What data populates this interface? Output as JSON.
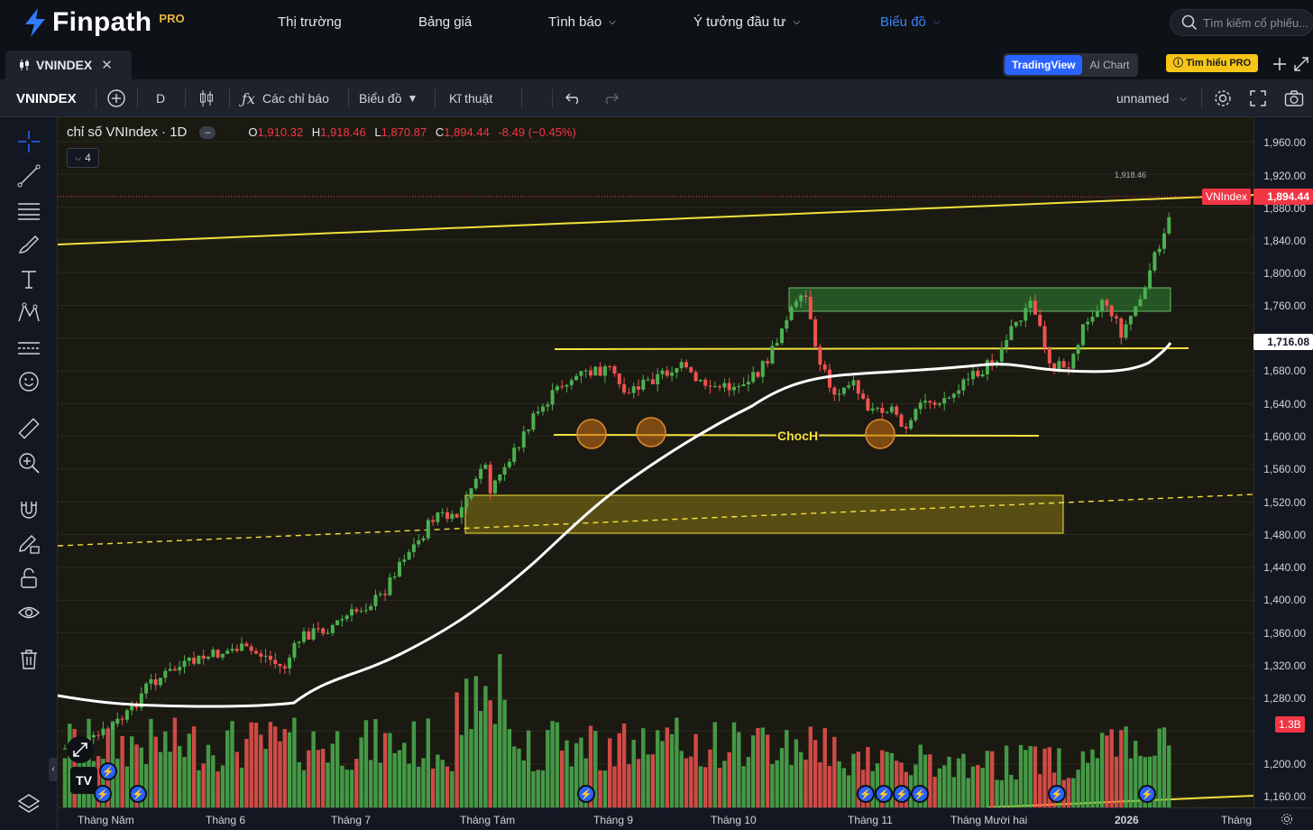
{
  "brand": {
    "name": "Finpath",
    "tier": "PRO"
  },
  "nav": [
    {
      "label": "Thị trường",
      "dropdown": false,
      "active": false
    },
    {
      "label": "Bảng giá",
      "dropdown": false,
      "active": false
    },
    {
      "label": "Tình báo",
      "dropdown": true,
      "active": false
    },
    {
      "label": "Ý tưởng đầu tư",
      "dropdown": true,
      "active": false
    },
    {
      "label": "Biểu đồ",
      "dropdown": true,
      "active": true
    }
  ],
  "search": {
    "placeholder": "Tìm kiếm cổ phiếu..."
  },
  "tab": {
    "symbol": "VNINDEX"
  },
  "chart_switch": {
    "tradingview": "TradingView",
    "ai": "AI Chart",
    "learn_pro": "Tìm hiểu PRO"
  },
  "toolbar": {
    "symbol": "VNINDEX",
    "interval": "D",
    "indicators": "Các chỉ báo",
    "chart_type": "Biểu đồ",
    "technical": "Kĩ thuật",
    "layout_name": "unnamed"
  },
  "legend": {
    "title": "chỉ số VNIndex · 1D",
    "o_key": "O",
    "o": "1,910.32",
    "h_key": "H",
    "h": "1,918.46",
    "l_key": "L",
    "l": "1,870.87",
    "c_key": "C",
    "c": "1,894.44",
    "change": "-8.49 (−0.45%)",
    "indicator_count": "4"
  },
  "annotations": {
    "choch": "ChocH",
    "high_label": "1,918.46"
  },
  "price_axis": {
    "ticks": [
      "1,960.00",
      "1,920.00",
      "1,880.00",
      "1,840.00",
      "1,800.00",
      "1,760.00",
      "1,680.00",
      "1,640.00",
      "1,600.00",
      "1,560.00",
      "1,520.00",
      "1,480.00",
      "1,440.00",
      "1,400.00",
      "1,360.00",
      "1,320.00",
      "1,280.00",
      "1,200.00",
      "1,160.00"
    ],
    "ma_value": "1,716.08",
    "last_label": "VNIndex",
    "last_value": "1,894.44",
    "volume_label": "1.3B"
  },
  "time_axis": [
    "Tháng Năm",
    "Tháng 6",
    "Tháng 7",
    "Tháng Tám",
    "Tháng 9",
    "Tháng 10",
    "Tháng 11",
    "Tháng Mười hai",
    "2026",
    "Tháng"
  ],
  "colors": {
    "up": "#26a69a",
    "down": "#ef5350",
    "up_bright": "#4caf50",
    "accent": "#2962ff",
    "trend": "#f5e13b",
    "ma": "#ffffff"
  }
}
